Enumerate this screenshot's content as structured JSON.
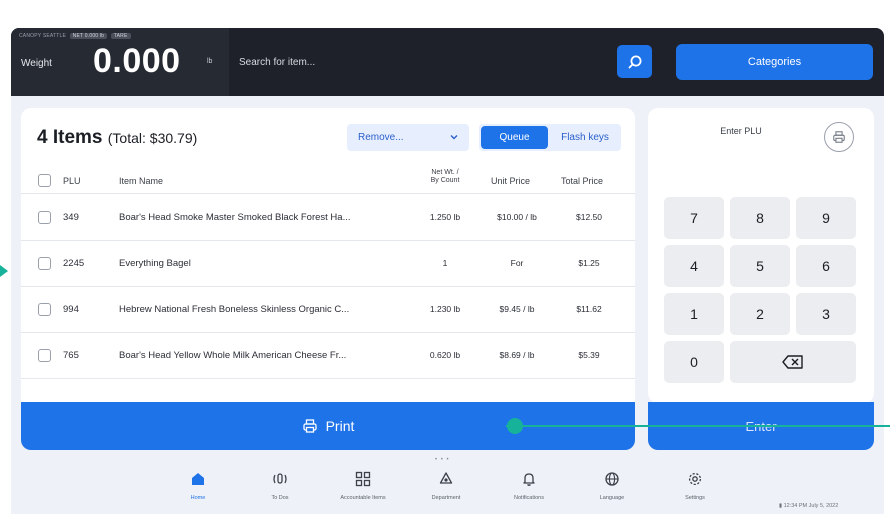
{
  "scale": {
    "meta": "CANOPY  SEATTLE",
    "meta_pill_1": "NET 0.000 lb",
    "meta_pill_2": "TARE",
    "weight_label": "Weight",
    "weight_value": "0.000",
    "weight_unit": "lb"
  },
  "search": {
    "placeholder": "Search for item..."
  },
  "header": {
    "categories_label": "Categories"
  },
  "cart": {
    "title": "4 Items",
    "total": "(Total: $30.79)",
    "remove_label": "Remove...",
    "tabs": {
      "queue": "Queue",
      "flash_keys": "Flash keys"
    },
    "columns": {
      "plu": "PLU",
      "name": "Item Name",
      "net_line1": "Net Wt. /",
      "net_line2": "By Count",
      "unit_price": "Unit Price",
      "total_price": "Total Price"
    },
    "rows": [
      {
        "plu": "349",
        "name": "Boar's Head Smoke Master Smoked Black Forest Ha...",
        "net": "1.250 lb",
        "unit": "$10.00 / lb",
        "total": "$12.50"
      },
      {
        "plu": "2245",
        "name": "Everything Bagel",
        "net": "1",
        "unit": "For",
        "total": "$1.25"
      },
      {
        "plu": "994",
        "name": "Hebrew National Fresh Boneless Skinless Organic C...",
        "net": "1.230 lb",
        "unit": "$9.45 / lb",
        "total": "$11.62"
      },
      {
        "plu": "765",
        "name": "Boar's Head Yellow Whole Milk American Cheese Fr...",
        "net": "0.620 lb",
        "unit": "$8.69 / lb",
        "total": "$5.39"
      }
    ],
    "print_label": "Print"
  },
  "keypad": {
    "title": "Enter PLU",
    "keys": [
      "7",
      "8",
      "9",
      "4",
      "5",
      "6",
      "1",
      "2",
      "3",
      "0"
    ],
    "enter_label": "Enter"
  },
  "pager": "• • •",
  "nav": [
    {
      "label": "Home",
      "icon": "home-icon"
    },
    {
      "label": "To Dos",
      "icon": "podcast-icon"
    },
    {
      "label": "Accountable Items",
      "icon": "grid-icon"
    },
    {
      "label": "Department",
      "icon": "recycle-icon"
    },
    {
      "label": "Notifications",
      "icon": "bell-icon"
    },
    {
      "label": "Language",
      "icon": "globe-icon"
    },
    {
      "label": "Settings",
      "icon": "gear-icon"
    }
  ],
  "status": {
    "time": "12:34 PM",
    "date": "July 5, 2022"
  },
  "colors": {
    "accent": "#1f73e8",
    "annotation": "#16b39a",
    "topbar": "#1e2129"
  }
}
